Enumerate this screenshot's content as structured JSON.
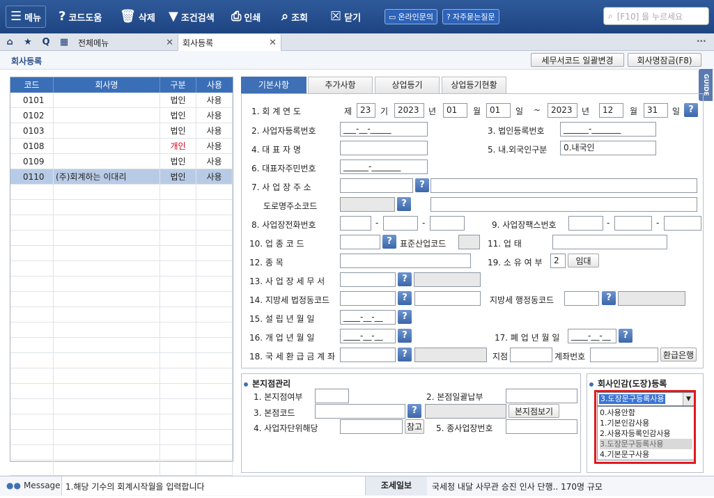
{
  "toolbar": {
    "menu": "메뉴",
    "code_help": "코드도움",
    "delete": "삭제",
    "cond_search": "조건검색",
    "print": "인쇄",
    "lookup": "조회",
    "close": "닫기",
    "online_inquiry": "온라인문의",
    "faq": "자주묻는질문",
    "search_placeholder": "[F10] 을 누르세요"
  },
  "tabs": {
    "all_menu": "전체메뉴",
    "company_reg": "회사등록"
  },
  "page": {
    "title": "회사등록",
    "btn_tax_office": "세무서코드 일괄변경",
    "btn_name_lock": "회사명잠금(F8)",
    "guide": "GUIDE"
  },
  "list": {
    "headers": [
      "코드",
      "회사명",
      "구분",
      "사용"
    ],
    "rows": [
      {
        "code": "0101",
        "name": "",
        "type": "법인",
        "use": "사용"
      },
      {
        "code": "0102",
        "name": "",
        "type": "법인",
        "use": "사용"
      },
      {
        "code": "0103",
        "name": "",
        "type": "법인",
        "use": "사용"
      },
      {
        "code": "0108",
        "name": "",
        "type": "개인",
        "use": "사용"
      },
      {
        "code": "0109",
        "name": "",
        "type": "법인",
        "use": "사용"
      },
      {
        "code": "0110",
        "name": "(주)회계하는 이대리",
        "type": "법인",
        "use": "사용"
      }
    ],
    "personal_color": "#d0021b"
  },
  "form_tabs": [
    "기본사항",
    "추가사항",
    "상업등기",
    "상업등기현황"
  ],
  "form": {
    "f1": {
      "label": "1. 회 계 연 도",
      "je": "제",
      "period": "23",
      "gi": "기",
      "start_year": "2023",
      "nyeon": "년",
      "start_month": "01",
      "wol": "월",
      "start_day": "01",
      "il": "일",
      "tilde": "~",
      "end_year": "2023",
      "end_month": "12",
      "end_day": "31"
    },
    "f2": {
      "label": "2. 사업자등록번호",
      "value": "___-__-_____"
    },
    "f3": {
      "label": "3. 법인등록번호",
      "value": "______-_______"
    },
    "f4": {
      "label": "4. 대 표 자 명",
      "value": ""
    },
    "f5": {
      "label": "5. 내.외국인구분",
      "value": "0.내국인"
    },
    "f6": {
      "label": "6. 대표자주민번호",
      "value": "______-_______"
    },
    "f7": {
      "label": "7. 사 업 장 주 소"
    },
    "road": {
      "label": "도로명주소코드"
    },
    "f8": {
      "label": "8. 사업장전화번호",
      "dash": "-"
    },
    "f9": {
      "label": "9. 사업장팩스번호"
    },
    "f10": {
      "label": "10. 업 종 코 드",
      "std_label": "표준산업코드"
    },
    "f11": {
      "label": "11. 업 태"
    },
    "f12": {
      "label": "12. 종 목"
    },
    "f19": {
      "label": "19. 소 유 여 부",
      "value": "2",
      "btn": "임대"
    },
    "f13": {
      "label": "13. 사 업 장 세 무 서"
    },
    "f14": {
      "label": "14. 지방세 법정동코드",
      "admin_label": "지방세 행정동코드"
    },
    "f15": {
      "label": "15. 설 립 년 월 일",
      "value": "____-__-__"
    },
    "f16": {
      "label": "16. 개 업 년 월 일",
      "value": "____-__-__"
    },
    "f17": {
      "label": "17. 폐 업 년 월 일",
      "value": "____-__-__"
    },
    "f18": {
      "label": "18. 국 세 환 급 금 계 좌",
      "branch": "지점",
      "account": "계좌번호",
      "btn": "환급은행"
    }
  },
  "branch": {
    "title": "본지점관리",
    "b1": "1. 본지점여부",
    "b2": "2. 본점일괄납부",
    "b3": "3. 본점코드",
    "b3_btn": "본지점보기",
    "b4": "4. 사업자단위해당",
    "b4_btn": "참고",
    "b5": "5. 종사업장번호"
  },
  "seal": {
    "title": "회사인감(도장)등록",
    "selected": "3.도장문구등록사용",
    "options": [
      "0.사용안함",
      "1.기본인감사용",
      "2.사용자등록인감사용",
      "3.도장문구등록사용",
      "4.기본문구사용"
    ]
  },
  "status": {
    "message_label": "Message",
    "message": "1.해당 기수의 회계시작월을 입력합니다",
    "news_label": "조세일보",
    "news": "국세청 내달 사무관 승진 인사 단행.. 170명 규모"
  }
}
